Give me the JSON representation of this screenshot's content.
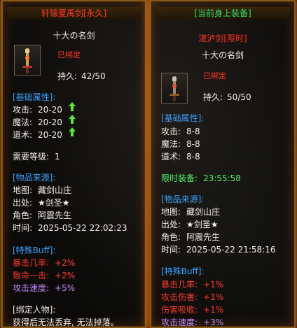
{
  "left": {
    "header": "轩辕夏禹剑[永久]",
    "item_name": "十大の名剑",
    "bound": "已绑定",
    "durability_label": "持久:",
    "durability_value": "42/50",
    "base_title": "[基础属性]:",
    "stats": [
      {
        "label": "攻击:",
        "value": "20-20"
      },
      {
        "label": "魔法:",
        "value": "20-20"
      },
      {
        "label": "道术:",
        "value": "20-20"
      }
    ],
    "level_req_label": "需要等级:",
    "level_req_value": "1",
    "source_title": "[物品来源]:",
    "source": [
      {
        "label": "地图:",
        "value": "藏剑山庄"
      },
      {
        "label": "出处:",
        "value": "★剑圣★"
      },
      {
        "label": "角色:",
        "value": "阿震先生"
      },
      {
        "label": "时间:",
        "value": "2025-05-22 22:02:23"
      }
    ],
    "buff_title": "[特殊Buff]:",
    "buffs": [
      {
        "label": "暴击几率:",
        "value": "+2%"
      },
      {
        "label": "致命一击:",
        "value": "+2%"
      },
      {
        "label": "攻击速度:",
        "value": "+5%"
      }
    ],
    "bind_title": "[绑定人物]:",
    "bind_text": "获得后无法丢弃, 无法掉落。"
  },
  "right": {
    "header": "[当前身上装备]",
    "item_name": "十大の名剑",
    "subtitle": "湛泸剑[限时]",
    "bound": "已绑定",
    "durability_label": "持久:",
    "durability_value": "50/50",
    "base_title": "[基础属性]:",
    "stats": [
      {
        "label": "攻击:",
        "value": "8-8"
      },
      {
        "label": "魔法:",
        "value": "8-8"
      },
      {
        "label": "道术:",
        "value": "8-8"
      }
    ],
    "limited_label": "限时装备:",
    "limited_value": "23:55:58",
    "source_title": "[物品来源]:",
    "source": [
      {
        "label": "地图:",
        "value": "藏剑山庄"
      },
      {
        "label": "出处:",
        "value": "★剑圣★"
      },
      {
        "label": "角色:",
        "value": "阿震先生"
      },
      {
        "label": "时间:",
        "value": "2025-05-22 21:58:16"
      }
    ],
    "buff_title": "[特殊Buff]:",
    "buffs": [
      {
        "label": "暴击几率:",
        "value": "+1%"
      },
      {
        "label": "攻击伤害:",
        "value": "+1%"
      },
      {
        "label": "伤害吸收:",
        "value": "+1%"
      },
      {
        "label": "攻击速度:",
        "value": "+3%"
      }
    ]
  },
  "colors": {
    "header_red": "#ff3b2b",
    "header_green": "#2ee06a",
    "section_blue": "#3aa3ff",
    "bound_red": "#ff3326",
    "buff_red": "#ff3a30",
    "buff_purple": "#c58bff",
    "arrow_green": "#5fe23b",
    "frame_orange": "#8a5a16"
  },
  "icons": {
    "item_slot": "sword-icon",
    "upgrade": "up-arrow-icon"
  }
}
